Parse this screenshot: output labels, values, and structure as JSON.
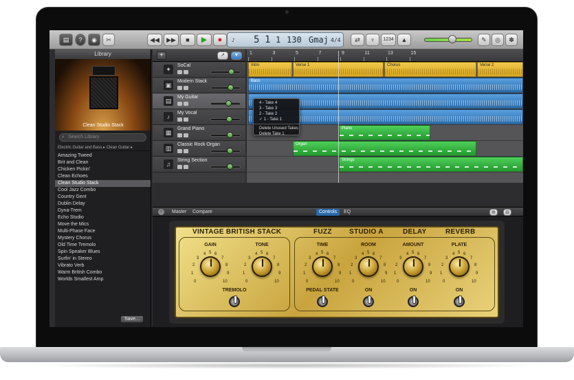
{
  "toolbar": {
    "lcd_bar": "5",
    "lcd_beat": "1",
    "lcd_div": "1",
    "lcd_tempo": "130",
    "lcd_key": "Gmaj",
    "lcd_sig": "4/4",
    "lcd_label": "1234"
  },
  "library": {
    "title": "Library",
    "preview_name": "Clean Studio Stack",
    "search_placeholder": "Search Library",
    "breadcrumb": "Electric Guitar and Bass ▸ Clean Guitar ▸",
    "items": [
      "Amazing Tweed",
      "Brit and Clean",
      "Chicken Pickin'",
      "Clean Echoes",
      "Clean Studio Stack",
      "Cool Jazz Combo",
      "Country Gent",
      "Dublin Delay",
      "Dyna-Trem",
      "Echo Studio",
      "Move the Mics",
      "Multi-Phase Face",
      "Mystery Chorus",
      "Old Time Tremolo",
      "Spin Speaker Blues",
      "Surfin' in Stereo",
      "Vibrato Verb",
      "Warm British Combo",
      "Worlds Smallest Amp"
    ],
    "selected_index": 4,
    "save_label": "Save..."
  },
  "tracks": [
    {
      "name": "SoCal",
      "icon": "drums-icon",
      "glyph": "✦",
      "volume": 0.65
    },
    {
      "name": "Modern Stack",
      "icon": "bass-amp-icon",
      "glyph": "▣",
      "volume": 0.62
    },
    {
      "name": "My Guitar",
      "icon": "guitar-amp-icon",
      "glyph": "▤",
      "volume": 0.55
    },
    {
      "name": "My Vocal",
      "icon": "microphone-icon",
      "glyph": "♪",
      "volume": 0.58
    },
    {
      "name": "Grand Piano",
      "icon": "piano-icon",
      "glyph": "▦",
      "volume": 0.6
    },
    {
      "name": "Classic Rock Organ",
      "icon": "organ-icon",
      "glyph": "▥",
      "volume": 0.6
    },
    {
      "name": "String Section",
      "icon": "strings-icon",
      "glyph": "♫",
      "volume": 0.6
    }
  ],
  "ruler": {
    "marks": [
      "1",
      "3",
      "5",
      "7",
      "9",
      "11",
      "13",
      "15"
    ]
  },
  "regions": {
    "intro": "Intro",
    "verse1": "Verse 1",
    "chorus": "Chorus",
    "verse2": "Verse 2",
    "bass": "Bass",
    "piano": "Piano",
    "organ": "Organ",
    "strings": "Strings"
  },
  "takes_menu": {
    "items": [
      "4 - Take 4",
      "3 - Take 3",
      "2 - Take 2",
      "✓ 1 - Take 1"
    ],
    "actions": [
      "Delete Unused Takes",
      "Delete Take 1"
    ]
  },
  "smart_controls": {
    "info": "i",
    "tabs": {
      "master": "Master",
      "compare": "Compare",
      "controls": "Controls",
      "eq": "EQ"
    },
    "amp": {
      "stack_title": "VINTAGE BRITISH STACK",
      "fx_titles": [
        "FUZZ",
        "STUDIO A",
        "DELAY",
        "REVERB"
      ],
      "gain": "GAIN",
      "tone": "TONE",
      "tremolo": "TREMOLO",
      "time": "TIME",
      "room": "ROOM",
      "amount": "AMOUNT",
      "plate": "PLATE",
      "pedal_state": "PEDAL STATE",
      "on1": "ON",
      "on2": "ON",
      "on3": "ON",
      "scale": [
        "0",
        "1",
        "2",
        "3",
        "4",
        "5",
        "6",
        "7",
        "8",
        "9",
        "10"
      ]
    }
  }
}
